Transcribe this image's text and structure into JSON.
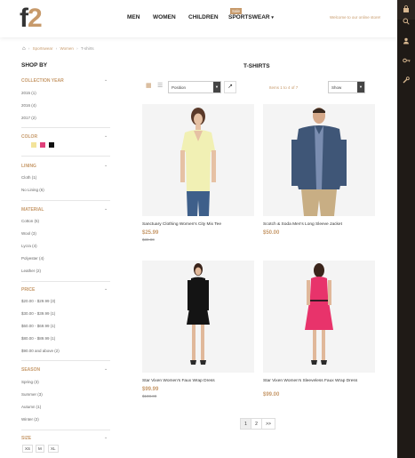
{
  "header": {
    "logo_main": "f",
    "logo_accent": "2",
    "nav": [
      "MEN",
      "WOMEN",
      "CHILDREN",
      "SPORTSWEAR"
    ],
    "sale_badge": "Sale",
    "welcome": "Welcome to our online store!"
  },
  "breadcrumb": [
    "Sportswear",
    "Women",
    "T-shirts"
  ],
  "sidebar": {
    "title": "SHOP BY",
    "filters": {
      "collection_year": {
        "title": "COLLECTION YEAR",
        "items": [
          "2015 (1)",
          "2016 (4)",
          "2017 (2)"
        ]
      },
      "color": {
        "title": "COLOR",
        "swatches": [
          "#f3e39a",
          "#e0407a",
          "#111111"
        ]
      },
      "lining": {
        "title": "LINING",
        "items": [
          "Cloth (1)",
          "No Lining (6)"
        ]
      },
      "material": {
        "title": "MATERIAL",
        "items": [
          "Cotton (5)",
          "Wool (3)",
          "Lycra (4)",
          "Polyester (4)",
          "Leather (2)"
        ]
      },
      "price": {
        "title": "PRICE",
        "items": [
          "$20.00 - $29.99 (3)",
          "$30.00 - $39.99 (1)",
          "$60.00 - $69.99 (1)",
          "$80.00 - $89.99 (1)",
          "$90.00 and above (2)"
        ]
      },
      "season": {
        "title": "SEASON",
        "items": [
          "Spring (3)",
          "Summer (3)",
          "Autumn (1)",
          "Winter (2)"
        ]
      },
      "size": {
        "title": "SIZE",
        "items": [
          "XS",
          "M",
          "XL"
        ]
      }
    }
  },
  "main": {
    "title": "T-SHIRTS",
    "sort_value": "Position",
    "items_count": "Items 1 to 4 of 7",
    "show_value": "Show",
    "products": [
      {
        "name": "Sanctuary Clothing Women's City Mix Tee",
        "price": "$25.99",
        "old_price": "$30.00"
      },
      {
        "name": "Scotch & Soda Men's Long Sleeve Jacket",
        "price": "$50.00",
        "old_price": ""
      },
      {
        "name": "Star Vixen Women's Faux Wrap Dress",
        "price": "$99.99",
        "old_price": "$108.00"
      },
      {
        "name": "Star Vixen Women's Sleeveless Faux Wrap Dress",
        "price": "$99.00",
        "old_price": ""
      }
    ],
    "pager": [
      "1",
      "2",
      ">>"
    ]
  }
}
